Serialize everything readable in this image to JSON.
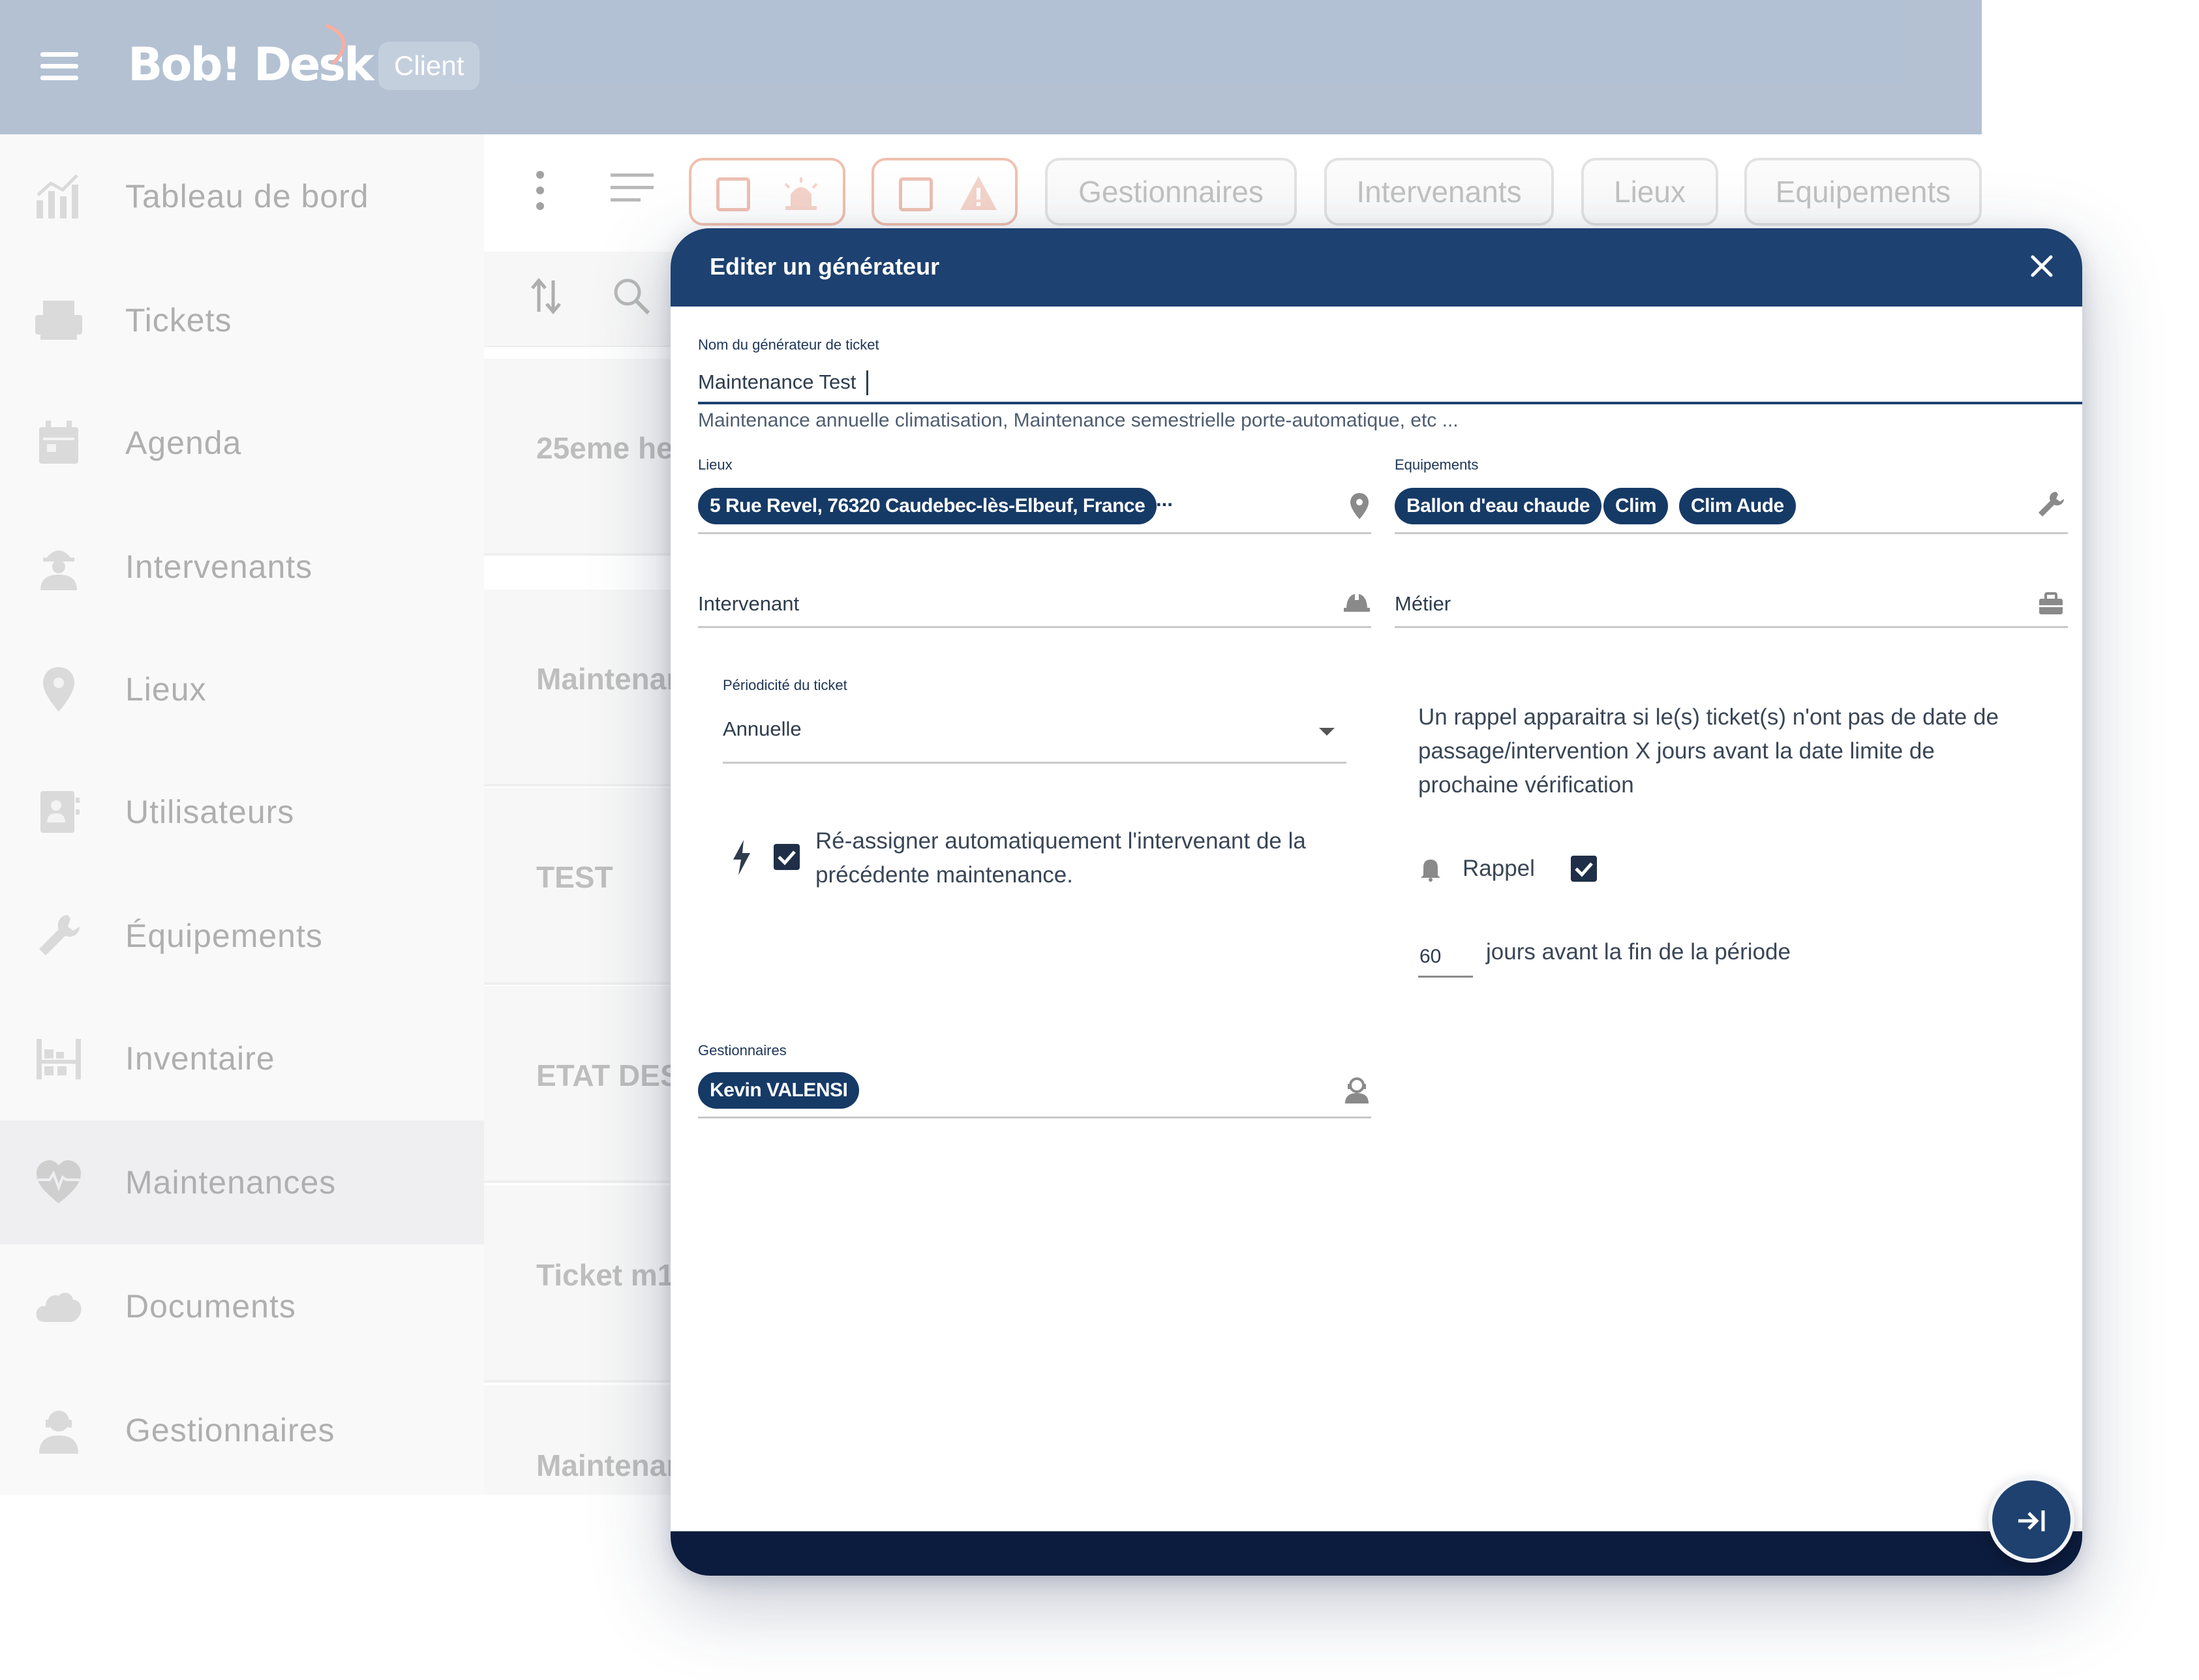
{
  "topbar": {
    "brand": "Bob! Desk",
    "badge": "Client"
  },
  "sidebar": {
    "items": [
      {
        "label": "Tableau de bord",
        "icon": "bar-chart-icon"
      },
      {
        "label": "Tickets",
        "icon": "printer-icon"
      },
      {
        "label": "Agenda",
        "icon": "calendar-icon"
      },
      {
        "label": "Intervenants",
        "icon": "worker-icon"
      },
      {
        "label": "Lieux",
        "icon": "location-pin-icon"
      },
      {
        "label": "Utilisateurs",
        "icon": "user-card-icon"
      },
      {
        "label": "Équipements",
        "icon": "wrench-icon"
      },
      {
        "label": "Inventaire",
        "icon": "inventory-icon"
      },
      {
        "label": "Maintenances",
        "icon": "heartbeat-icon",
        "active": true
      },
      {
        "label": "Documents",
        "icon": "cloud-icon"
      },
      {
        "label": "Gestionnaires",
        "icon": "manager-icon"
      }
    ]
  },
  "toolbar": {
    "chips": [
      "Gestionnaires",
      "Intervenants",
      "Lieux",
      "Equipements"
    ]
  },
  "list": {
    "rows": [
      "25eme he",
      "Maintenar",
      "TEST",
      "ETAT DES",
      "Ticket m1",
      "Maintenar"
    ]
  },
  "modal": {
    "title": "Editer un générateur",
    "name_label": "Nom du générateur de ticket",
    "name_value": "Maintenance Test",
    "name_hint": "Maintenance annuelle climatisation, Maintenance semestrielle porte-automatique, etc ...",
    "lieux_label": "Lieux",
    "lieux_chip": "5 Rue Revel, 76320 Caudebec-lès-Elbeuf, France",
    "lieux_more": "...",
    "equipements_label": "Equipements",
    "equipements_chips": [
      "Ballon d'eau chaude",
      "Clim",
      "Clim Aude"
    ],
    "intervenant_placeholder": "Intervenant",
    "metier_placeholder": "Métier",
    "periodicite_label": "Périodicité du ticket",
    "periodicite_value": "Annuelle",
    "reassign_text_line1": "Ré-assigner automatiquement l'intervenant de la",
    "reassign_text_line2": "précédente maintenance.",
    "reassign_checked": true,
    "reminder_info_line1": "Un rappel apparaitra si le(s) ticket(s) n'ont pas de date de",
    "reminder_info_line2": "passage/intervention X jours avant la date limite de",
    "reminder_info_line3": "prochaine vérification",
    "rappel_label": "Rappel",
    "rappel_checked": true,
    "days_value": "60",
    "days_suffix": "jours avant la fin de la période",
    "gestionnaires_label": "Gestionnaires",
    "gestionnaires_chip": "Kevin VALENSI"
  },
  "colors": {
    "topbar": "#8fa4bf",
    "modal_header": "#1d4170",
    "chip": "#163a66",
    "footer": "#0c1c3e"
  }
}
